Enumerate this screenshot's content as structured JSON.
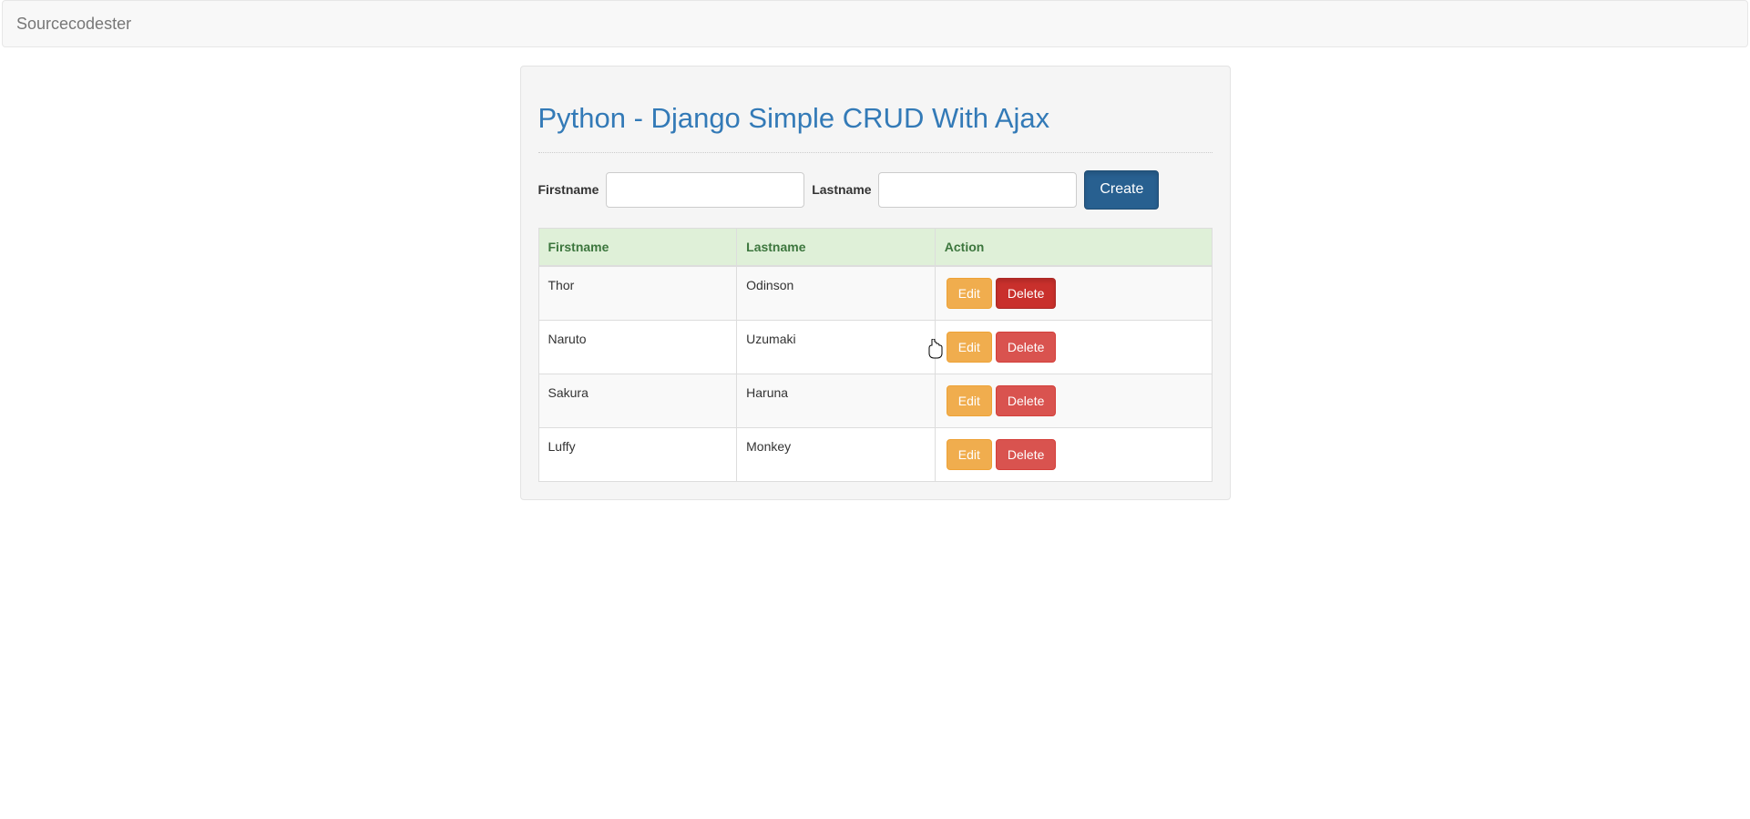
{
  "navbar": {
    "brand": "Sourcecodester"
  },
  "page": {
    "title": "Python - Django Simple CRUD With Ajax"
  },
  "form": {
    "firstname_label": "Firstname",
    "lastname_label": "Lastname",
    "firstname_value": "",
    "lastname_value": "",
    "create_label": "Create"
  },
  "table": {
    "headers": {
      "firstname": "Firstname",
      "lastname": "Lastname",
      "action": "Action"
    },
    "edit_label": "Edit",
    "delete_label": "Delete",
    "rows": [
      {
        "firstname": "Thor",
        "lastname": "Odinson"
      },
      {
        "firstname": "Naruto",
        "lastname": "Uzumaki"
      },
      {
        "firstname": "Sakura",
        "lastname": "Haruna"
      },
      {
        "firstname": "Luffy",
        "lastname": "Monkey"
      }
    ]
  },
  "state": {
    "active_delete_row": 0
  }
}
